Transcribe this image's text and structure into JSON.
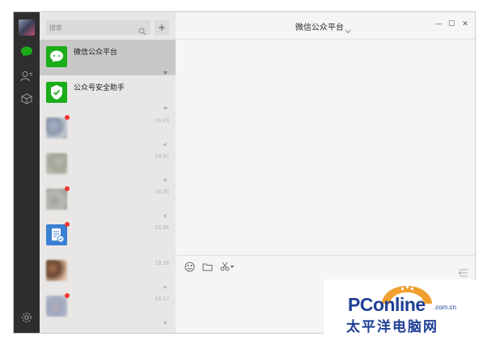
{
  "sidebar": {
    "icons": [
      "chat-icon",
      "contacts-icon",
      "favorites-icon",
      "settings-icon"
    ]
  },
  "chat_list": {
    "search_placeholder": "搜索",
    "add_label": "+",
    "items": [
      {
        "name": "微信公众平台",
        "time": "",
        "active": true,
        "badge": false,
        "pinned": true
      },
      {
        "name": "公众号安全助手",
        "time": "",
        "active": false,
        "badge": false,
        "pinned": true
      },
      {
        "name": "",
        "time": "16:43",
        "active": false,
        "badge": true,
        "pinned": false
      },
      {
        "name": "",
        "time": "16:37",
        "active": false,
        "badge": false,
        "pinned": false
      },
      {
        "name": "",
        "time": "16:36",
        "active": false,
        "badge": true,
        "pinned": false
      },
      {
        "name": "",
        "time": "16:34",
        "active": false,
        "badge": true,
        "pinned": false
      },
      {
        "name": "",
        "time": "16:18",
        "active": false,
        "badge": false,
        "pinned": false
      },
      {
        "name": "",
        "time": "16:17",
        "active": false,
        "badge": true,
        "pinned": false
      }
    ]
  },
  "chat": {
    "title": "微信公众平台",
    "window_controls": [
      "—",
      "☐",
      "✕"
    ],
    "toolbar": [
      "emoji-icon",
      "folder-icon",
      "scissors-icon"
    ]
  },
  "watermark": {
    "logo": "PConline",
    "domain": ".com.cn",
    "chinese": "太平洋电脑网"
  },
  "colors": {
    "rail": "#2e2e2e",
    "accent_green": "#1aad19",
    "badge_red": "#f43530",
    "watermark_blue": "#1f3f95",
    "watermark_orange": "#f0a030"
  }
}
